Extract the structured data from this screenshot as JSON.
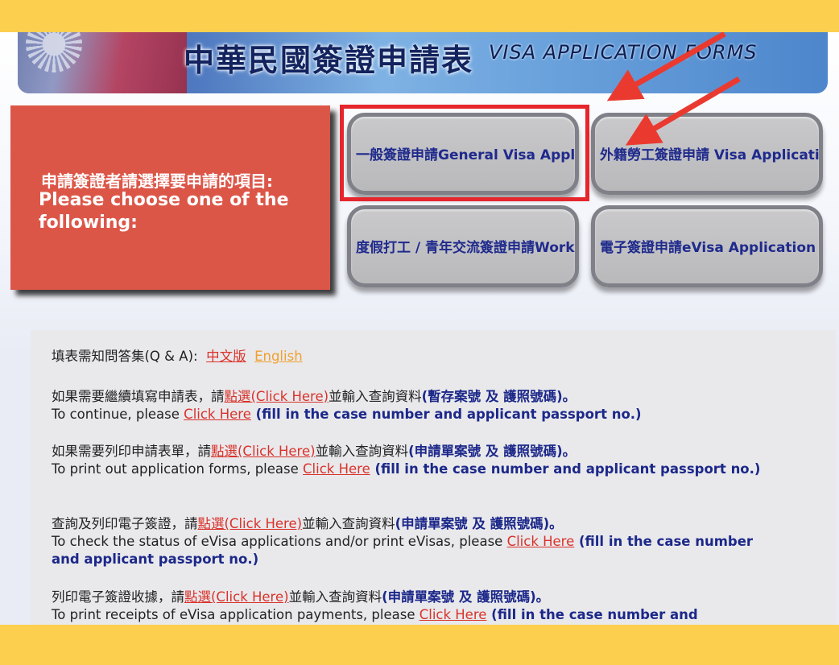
{
  "banner": {
    "title_zh": "中華民國簽證申請表",
    "title_en": "VISA APPLICATION FORMS"
  },
  "prompt": {
    "zh": "申請簽證者請選擇要申請的項目:",
    "en": "Please choose one of the following:"
  },
  "options": [
    {
      "label": "一般簽證申請General Visa Application"
    },
    {
      "label": "外籍勞工簽證申請 Visa Application for Migrant Workers"
    },
    {
      "label": "度假打工 / 青年交流簽證申請Working Holiday Visa"
    },
    {
      "label": "電子簽證申請eVisa Application"
    }
  ],
  "qa": {
    "label": "填表需知問答集(Q & A):",
    "zh_link": "中文版",
    "en_link": "English"
  },
  "sections": [
    {
      "zh_pre": "如果需要繼續填寫申請表，請",
      "zh_link": "點選(Click Here)",
      "zh_post": "並輸入查詢資料",
      "zh_bold": "(暫存案號 及 護照號碼)。",
      "en_pre": "To continue, please ",
      "en_link": "Click Here",
      "en_bold": " (fill in the case number and applicant passport no.)"
    },
    {
      "zh_pre": "如果需要列印申請表單，請",
      "zh_link": "點選(Click Here)",
      "zh_post": "並輸入查詢資料",
      "zh_bold": "(申請單案號 及 護照號碼)。",
      "en_pre": "To print out application forms, please ",
      "en_link": "Click Here",
      "en_bold": " (fill in the case number and applicant passport no.)"
    },
    {
      "zh_pre": "查詢及列印電子簽證，請",
      "zh_link": "點選(Click Here)",
      "zh_post": "並輸入查詢資料",
      "zh_bold": "(申請單案號 及 護照號碼)。",
      "en_pre": "To check the status of eVisa applications and/or print eVisas, please ",
      "en_link": "Click Here",
      "en_bold": " (fill in the case number and applicant passport no.)"
    },
    {
      "zh_pre": "列印電子簽證收據，請",
      "zh_link": "點選(Click Here)",
      "zh_post": "並輸入查詢資料",
      "zh_bold": "(申請單案號 及 護照號碼)。",
      "en_pre": "To print receipts of eVisa application payments, please ",
      "en_link": "Click Here",
      "en_bold": " (fill in the case number and"
    }
  ],
  "colors": {
    "frame": "#fccf4f",
    "prompt_box": "#dc5648",
    "link": "#d9322a",
    "link_alt": "#f0a02e",
    "bold_text": "#1c2889",
    "highlight": "#e5262c"
  },
  "annotations": {
    "highlight_box": "red-rectangle",
    "arrows": [
      "red-arrow",
      "red-arrow"
    ]
  }
}
